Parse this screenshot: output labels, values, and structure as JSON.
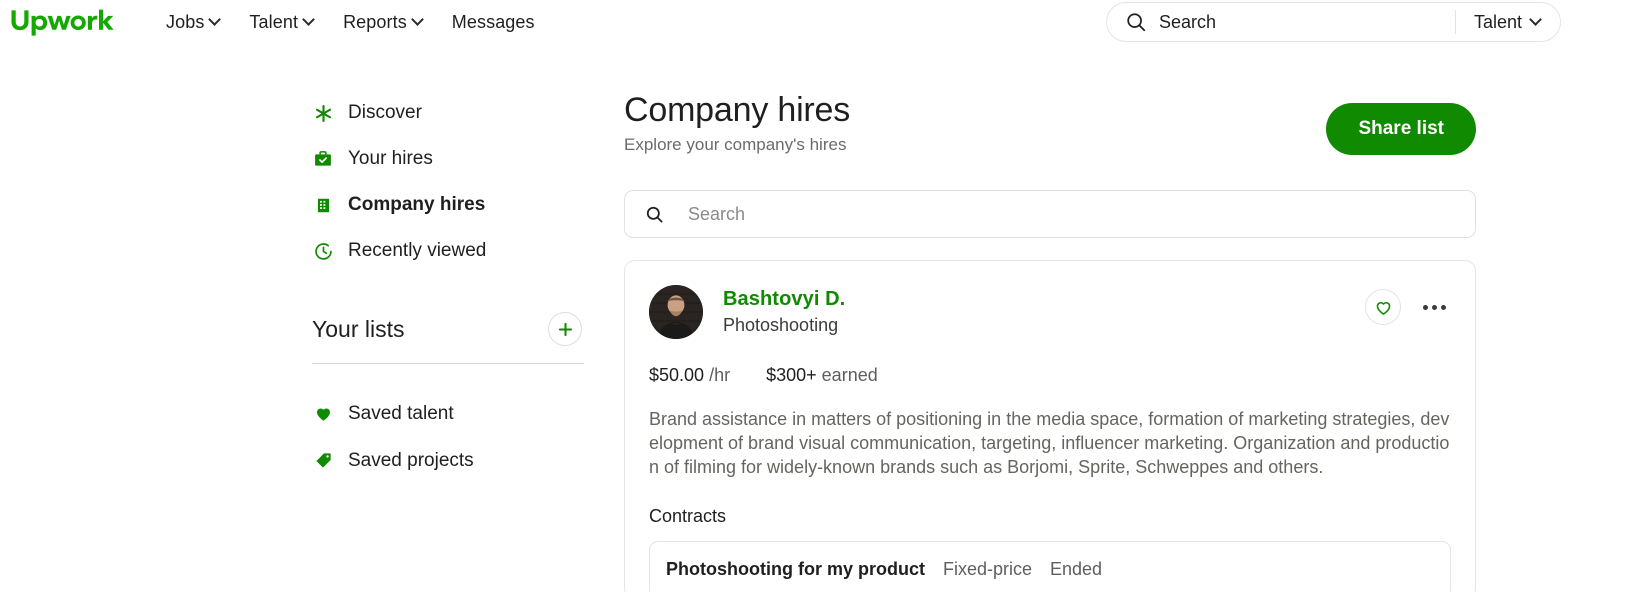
{
  "brand": {
    "name": "upwork",
    "color": "#14a800"
  },
  "topnav": {
    "links": [
      {
        "label": "Jobs",
        "has_caret": true
      },
      {
        "label": "Talent",
        "has_caret": true
      },
      {
        "label": "Reports",
        "has_caret": true
      },
      {
        "label": "Messages",
        "has_caret": false
      }
    ],
    "search": {
      "placeholder": "Search",
      "value": ""
    },
    "scope": {
      "label": "Talent"
    }
  },
  "sidebar": {
    "items": [
      {
        "label": "Discover",
        "icon": "sparkle-icon",
        "active": false
      },
      {
        "label": "Your hires",
        "icon": "briefcase-check-icon",
        "active": false
      },
      {
        "label": "Company hires",
        "icon": "building-icon",
        "active": true
      },
      {
        "label": "Recently viewed",
        "icon": "clock-icon",
        "active": false
      }
    ],
    "lists": {
      "title": "Your lists",
      "add_label": "+",
      "items": [
        {
          "label": "Saved talent",
          "icon": "heart-filled-icon"
        },
        {
          "label": "Saved projects",
          "icon": "tag-icon"
        }
      ]
    }
  },
  "main": {
    "title": "Company hires",
    "subtitle": "Explore your company's hires",
    "share_label": "Share list",
    "search": {
      "placeholder": "Search",
      "value": ""
    },
    "card": {
      "name": "Bashtovyi D.",
      "role": "Photoshooting",
      "rate_value": "$50.00",
      "rate_unit": "/hr",
      "earned_value": "$300+",
      "earned_label": "earned",
      "description": "Brand assistance in matters of positioning in the media space, formation of marketing strategies, development of brand visual communication, targeting, influencer marketing. Organization and production of filming for widely-known brands such as Borjomi, Sprite, Schweppes and others.",
      "contracts_label": "Contracts",
      "contracts": [
        {
          "title": "Photoshooting for my product",
          "type": "Fixed-price",
          "status": "Ended"
        }
      ]
    }
  },
  "colors": {
    "brand_green": "#14a800",
    "button_green": "#108a00",
    "link_green": "#108a00"
  }
}
